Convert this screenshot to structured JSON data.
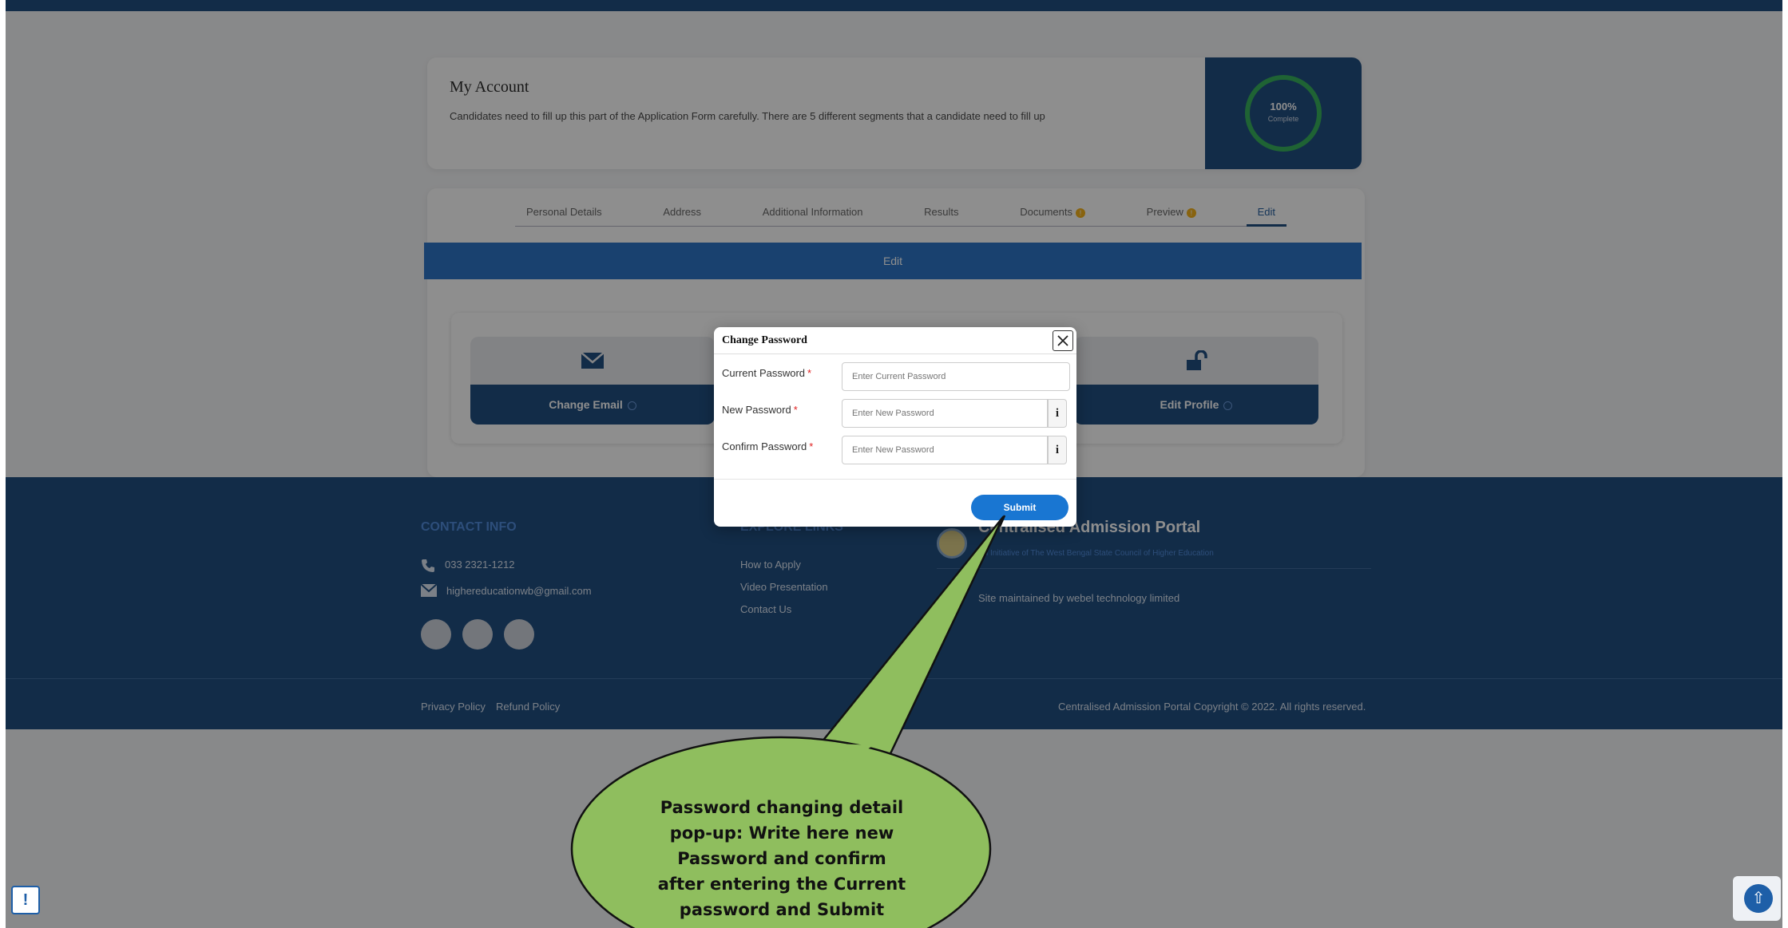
{
  "account": {
    "title": "My Account",
    "description": "Candidates need to fill up this part of the Application Form carefully. There are 5 different segments that a candidate need to fill up",
    "progress_percent": "100%",
    "progress_label": "Complete",
    "progress_value": 100
  },
  "tabs": [
    {
      "label": "Personal Details",
      "warning": false,
      "active": false
    },
    {
      "label": "Address",
      "warning": false,
      "active": false
    },
    {
      "label": "Additional Information",
      "warning": false,
      "active": false
    },
    {
      "label": "Results",
      "warning": false,
      "active": false
    },
    {
      "label": "Documents",
      "warning": true,
      "active": false
    },
    {
      "label": "Preview",
      "warning": true,
      "active": false
    },
    {
      "label": "Edit",
      "warning": false,
      "active": true
    }
  ],
  "edit_bar": {
    "label": "Edit"
  },
  "options": {
    "change_email": "Change Email",
    "edit_profile": "Edit Profile",
    "email_icon": "envelope-icon",
    "profile_icon": "unlock-icon"
  },
  "footer": {
    "contact_title": "CONTACT INFO",
    "phone": "033 2321-1212",
    "email": "highereducationwb@gmail.com",
    "explore_title": "EXPLORE LINKS",
    "links": [
      "How to Apply",
      "Video Presentation",
      "Contact Us"
    ],
    "portal_title": "Centralised Admission Portal",
    "portal_subtitle": "An Initiative of The West Bengal State Council of Higher Education",
    "maintained_by": "Site maintained by webel technology limited",
    "privacy": "Privacy Policy",
    "refund": "Refund Policy",
    "copyright": "Centralised Admission Portal Copyright © 2022. All rights reserved."
  },
  "modal": {
    "title": "Change Password",
    "current_label": "Current Password",
    "current_placeholder": "Enter Current Password",
    "new_label": "New Password",
    "new_placeholder": "Enter New Password",
    "confirm_label": "Confirm Password",
    "confirm_placeholder": "Enter New Password",
    "required_mark": "*",
    "info_symbol": "i",
    "submit_label": "Submit"
  },
  "callout": {
    "line1": "Password changing detail",
    "line2": "pop-up: Write here new",
    "line3": "Password and confirm",
    "line4": "after entering the Current",
    "line5": "password and Submit"
  },
  "colors": {
    "primary_dark": "#063a73",
    "primary": "#1565c0",
    "progress_green": "#20a84a",
    "warning": "#f2a900",
    "callout_green": "#8fbe5e"
  }
}
